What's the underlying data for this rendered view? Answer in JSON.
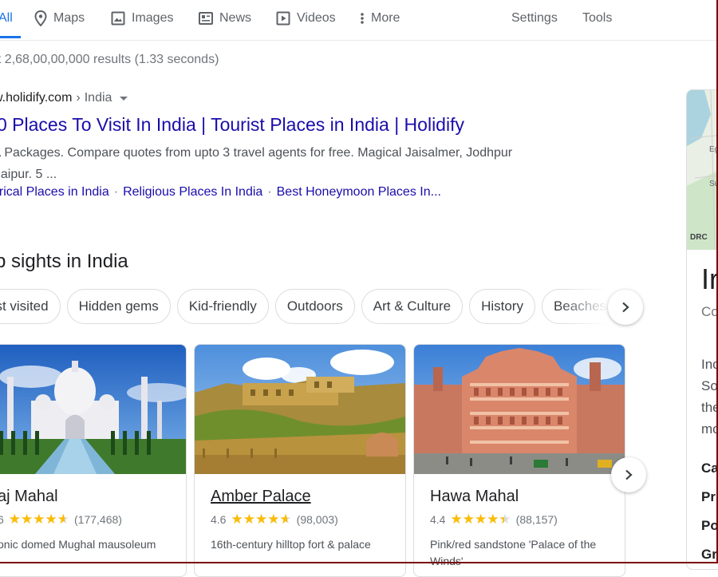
{
  "nav": {
    "all": "All",
    "maps": "Maps",
    "images": "Images",
    "news": "News",
    "videos": "Videos",
    "more": "More",
    "settings": "Settings",
    "tools": "Tools"
  },
  "stats": "ut 2,68,00,00,000 results (1.33 seconds)",
  "result": {
    "domain": "w.holidify.com",
    "separator": "›",
    "crumb": "India",
    "title": "0 Places To Visit In India | Tourist Places in India | Holidify",
    "snippet_bold": "a",
    "snippet_rest": "Packages. Compare quotes from upto 3 travel agents for free. Magical Jaisalmer, Jodhpur",
    "snippet_line2": "daipur. 5 ...",
    "sitelinks": [
      "orical Places in India",
      "Religious Places In India",
      "Best Honeymoon Places In..."
    ],
    "sitelink_sep": "·"
  },
  "sights": {
    "heading": "p sights in India",
    "chips": [
      "ost visited",
      "Hidden gems",
      "Kid-friendly",
      "Outdoors",
      "Art & Culture",
      "History",
      "Beaches"
    ],
    "cards": [
      {
        "title": "aj Mahal",
        "rating": "6",
        "rating_value": 4.6,
        "reviews": "(177,468)",
        "desc": "onic domed Mughal mausoleum"
      },
      {
        "title": "Amber Palace",
        "rating": "4.6",
        "rating_value": 4.6,
        "reviews": "(98,003)",
        "desc": "16th-century hilltop fort & palace"
      },
      {
        "title": "Hawa Mahal",
        "rating": "4.4",
        "rating_value": 4.4,
        "reviews": "(88,157)",
        "desc": "Pink/red sandstone 'Palace of the Winds'"
      }
    ]
  },
  "panel": {
    "map_labels": [
      "Eg",
      "Su",
      "DRC"
    ],
    "title": "Ir",
    "subtitle": "Co",
    "desc_lines": [
      "Inc",
      "So",
      "the",
      "mo"
    ],
    "facts": [
      "Ca",
      "Pr",
      "Po",
      "Gr"
    ]
  },
  "colors": {
    "link": "#1a0dab",
    "accent": "#1a73e8",
    "star": "#fbbc04",
    "text_secondary": "#70757a"
  }
}
